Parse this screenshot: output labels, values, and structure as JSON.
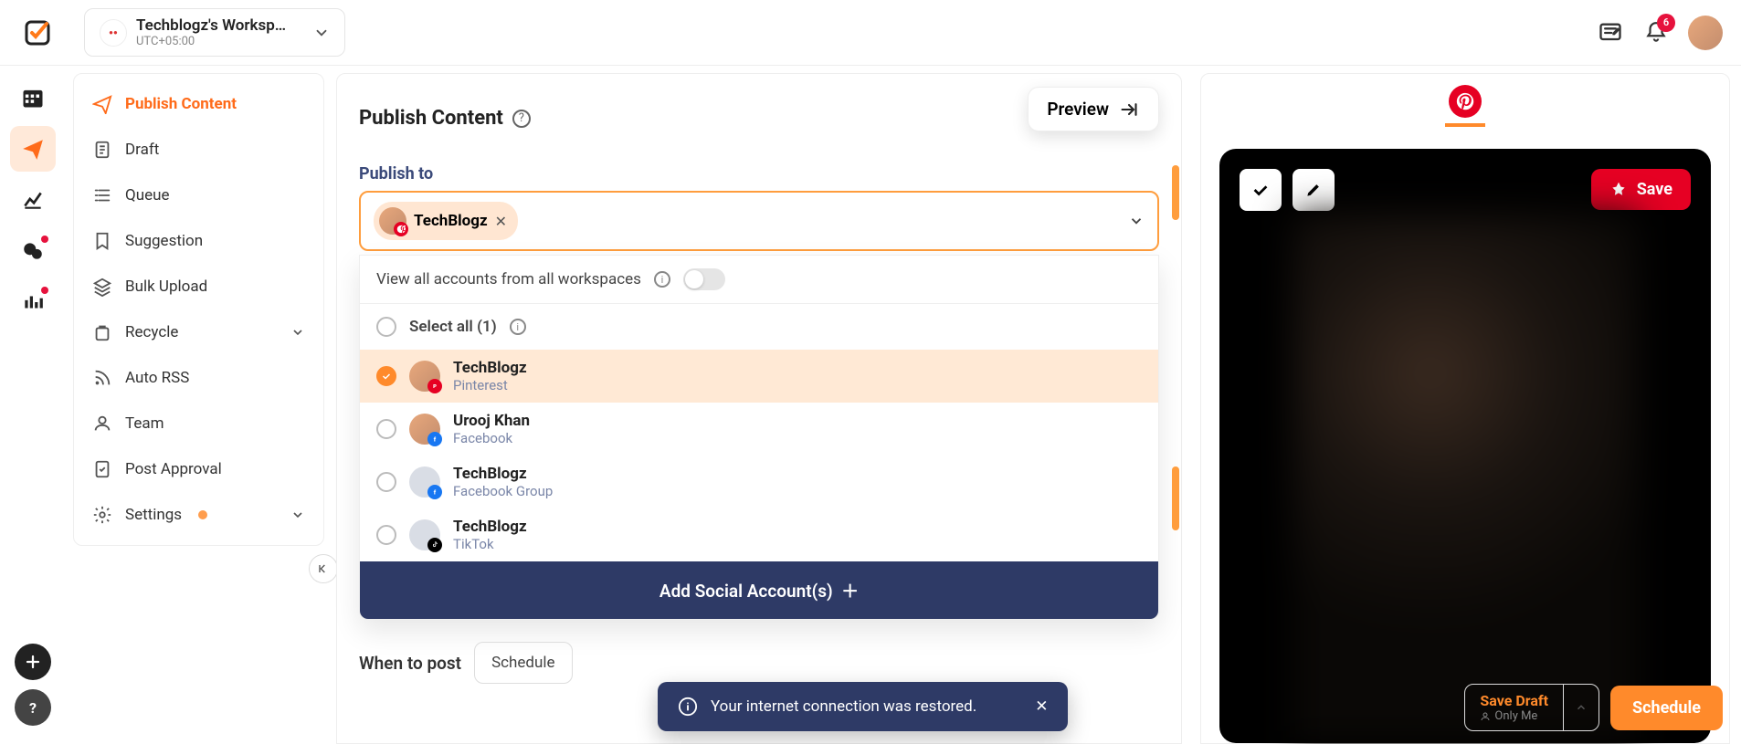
{
  "topbar": {
    "workspace_name": "Techblogz's Worksp…",
    "timezone": "UTC+05:00",
    "notification_count": "6"
  },
  "sidebar": {
    "items": [
      {
        "label": "Publish Content"
      },
      {
        "label": "Draft"
      },
      {
        "label": "Queue"
      },
      {
        "label": "Suggestion"
      },
      {
        "label": "Bulk Upload"
      },
      {
        "label": "Recycle"
      },
      {
        "label": "Auto RSS"
      },
      {
        "label": "Team"
      },
      {
        "label": "Post Approval"
      },
      {
        "label": "Settings"
      }
    ]
  },
  "compose": {
    "title": "Publish Content",
    "preview_label": "Preview",
    "publish_to_label": "Publish to",
    "chip_name": "TechBlogz",
    "view_all_label": "View all accounts from all workspaces",
    "select_all_label": "Select all (1)",
    "accounts": [
      {
        "name": "TechBlogz",
        "network": "Pinterest"
      },
      {
        "name": "Urooj Khan",
        "network": "Facebook"
      },
      {
        "name": "TechBlogz",
        "network": "Facebook Group"
      },
      {
        "name": "TechBlogz",
        "network": "TikTok"
      }
    ],
    "add_social_label": "Add Social Account(s)",
    "when_label": "When to post",
    "when_value": "Schedule"
  },
  "preview": {
    "save_label": "Save"
  },
  "footer": {
    "save_draft": "Save Draft",
    "only_me": "Only Me",
    "schedule": "Schedule"
  },
  "toast": {
    "message": "Your internet connection was restored."
  }
}
